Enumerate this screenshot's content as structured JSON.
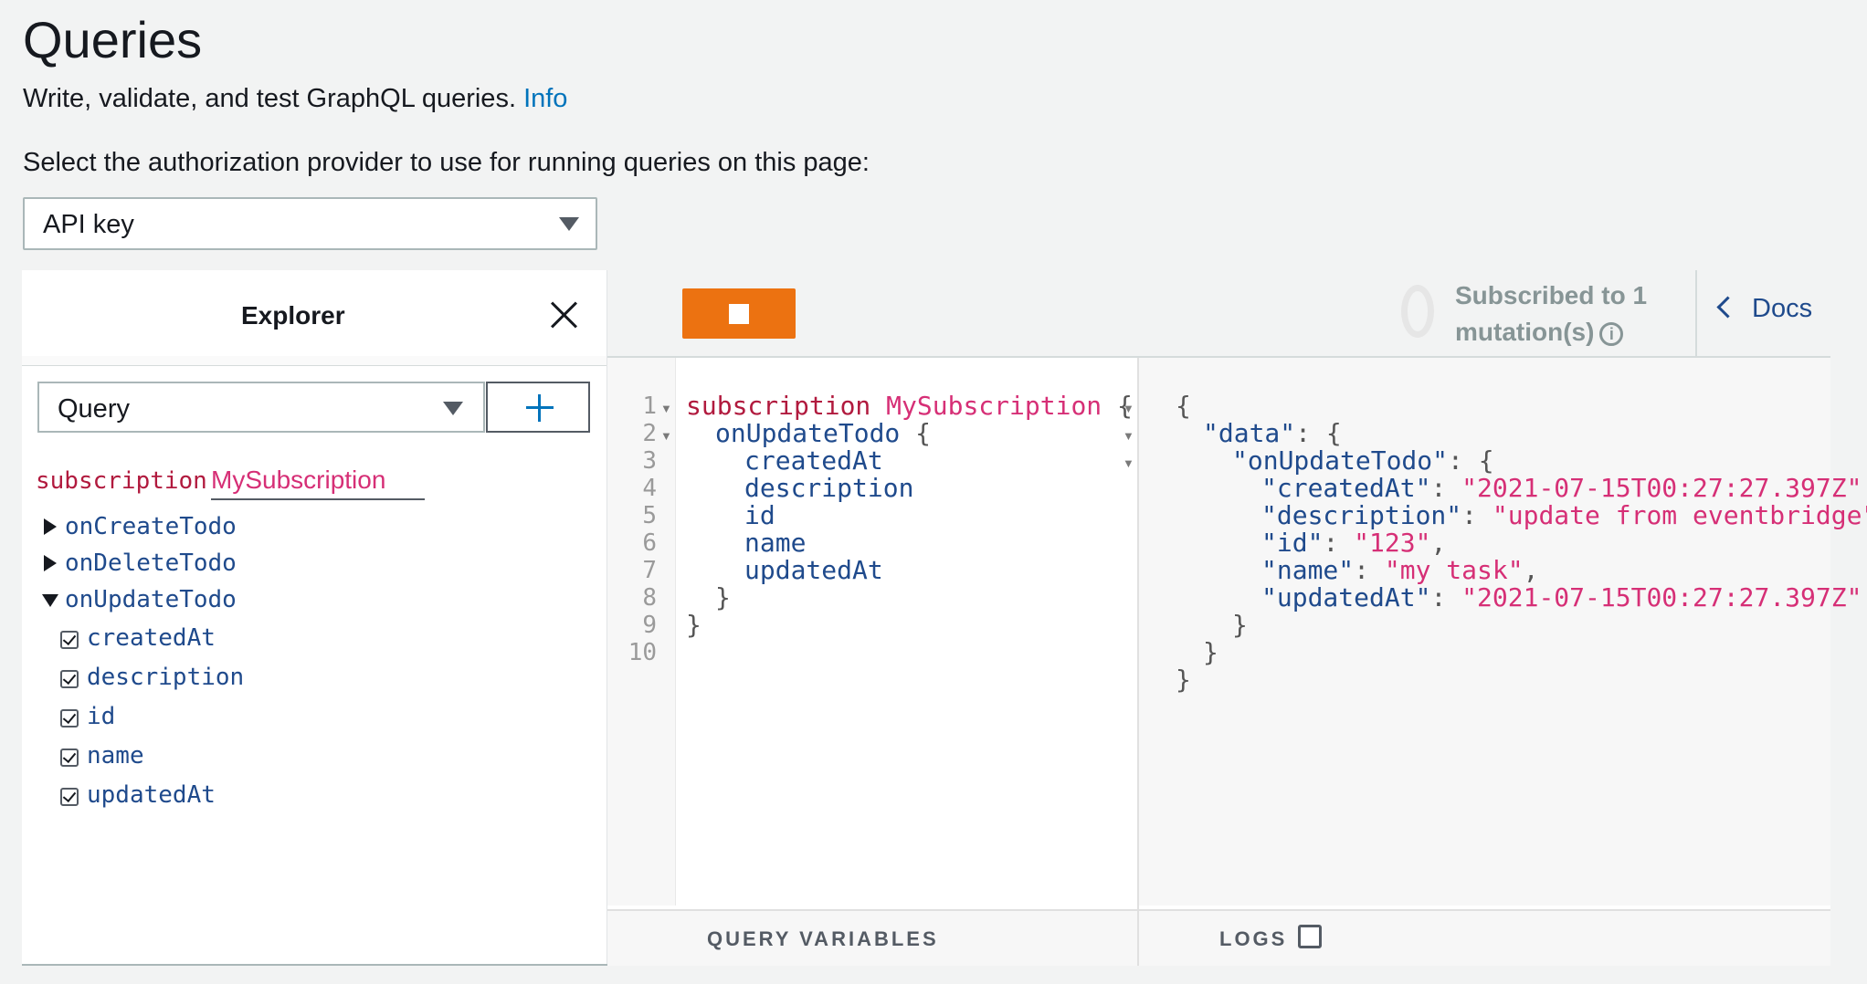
{
  "page": {
    "title": "Queries",
    "subtitle": "Write, validate, and test GraphQL queries.",
    "info_link": "Info",
    "auth_label": "Select the authorization provider to use for running queries on this page:",
    "auth_provider": "API key"
  },
  "explorer": {
    "title": "Explorer",
    "operation_type": "Query",
    "operation_keyword": "subscription",
    "operation_name": "MySubscription",
    "tree": [
      {
        "label": "onCreateTodo",
        "expanded": false
      },
      {
        "label": "onDeleteTodo",
        "expanded": false
      },
      {
        "label": "onUpdateTodo",
        "expanded": true
      }
    ],
    "fields": [
      "createdAt",
      "description",
      "id",
      "name",
      "updatedAt"
    ]
  },
  "toolbar": {
    "status_line1": "Subscribed to 1",
    "status_line2": "mutation(s)",
    "docs": "Docs",
    "info_glyph": "i"
  },
  "editor": {
    "line_numbers": [
      "1",
      "2",
      "3",
      "4",
      "5",
      "6",
      "7",
      "8",
      "9",
      "10"
    ],
    "kw": "subscription",
    "name": "MySubscription",
    "brace_open": "{",
    "brace_close": "}",
    "root_field": "onUpdateTodo",
    "fields": [
      "createdAt",
      "description",
      "id",
      "name",
      "updatedAt"
    ]
  },
  "result": {
    "open": "{",
    "close": "}",
    "data_key": "\"data\"",
    "root_key": "\"onUpdateTodo\"",
    "entries": [
      {
        "key": "\"createdAt\"",
        "value": "\"2021-07-15T00:27:27.397Z\"",
        "comma": ","
      },
      {
        "key": "\"description\"",
        "value": "\"update from eventbridge\"",
        "comma": ","
      },
      {
        "key": "\"id\"",
        "value": "\"123\"",
        "comma": ","
      },
      {
        "key": "\"name\"",
        "value": "\"my task\"",
        "comma": ","
      },
      {
        "key": "\"updatedAt\"",
        "value": "\"2021-07-15T00:27:27.397Z\"",
        "comma": ""
      }
    ]
  },
  "bottom": {
    "query_variables": "QUERY VARIABLES",
    "logs": "LOGS"
  }
}
